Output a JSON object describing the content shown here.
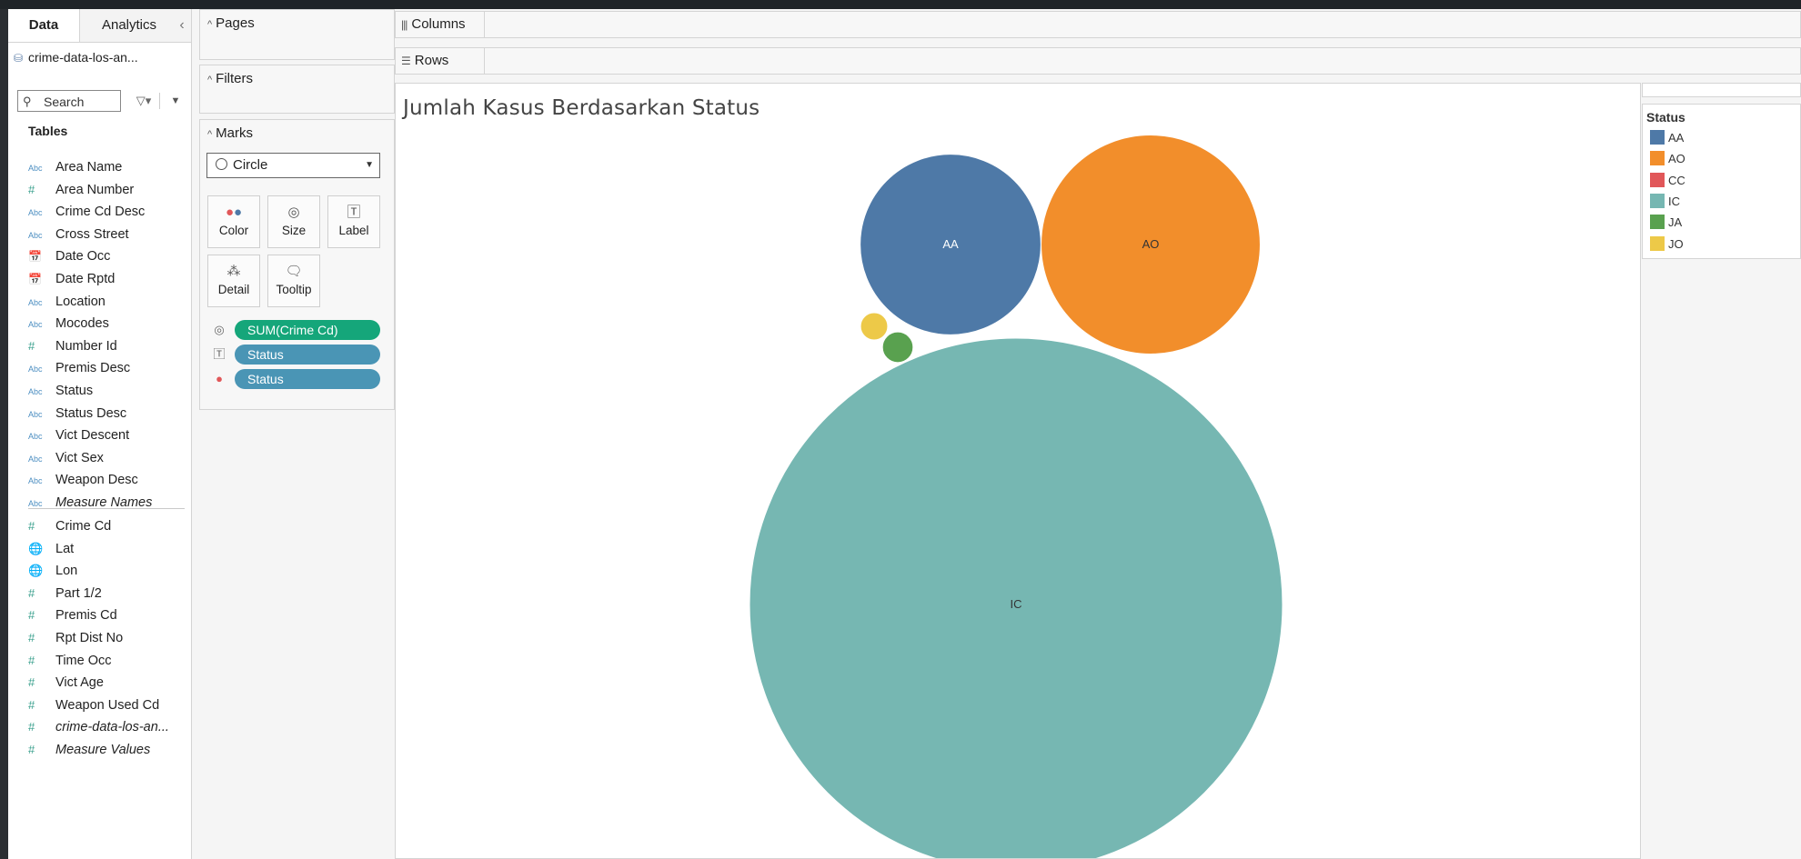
{
  "data_pane": {
    "tabs": [
      "Data",
      "Analytics"
    ],
    "datasource": "crime-data-los-an...",
    "search_placeholder": "Search",
    "tables_header": "Tables",
    "dimensions": [
      {
        "name": "Area Name",
        "type": "abc",
        "icon": "Abc"
      },
      {
        "name": "Area Number",
        "type": "num",
        "icon": "#"
      },
      {
        "name": "Crime Cd Desc",
        "type": "abc",
        "icon": "Abc"
      },
      {
        "name": "Cross Street",
        "type": "abc",
        "icon": "Abc"
      },
      {
        "name": "Date Occ",
        "type": "date",
        "icon": "📅"
      },
      {
        "name": "Date Rptd",
        "type": "date",
        "icon": "📅"
      },
      {
        "name": "Location",
        "type": "abc",
        "icon": "Abc"
      },
      {
        "name": "Mocodes",
        "type": "abc",
        "icon": "Abc"
      },
      {
        "name": "Number Id",
        "type": "num",
        "icon": "#"
      },
      {
        "name": "Premis Desc",
        "type": "abc",
        "icon": "Abc"
      },
      {
        "name": "Status",
        "type": "abc",
        "icon": "Abc"
      },
      {
        "name": "Status Desc",
        "type": "abc",
        "icon": "Abc"
      },
      {
        "name": "Vict Descent",
        "type": "abc",
        "icon": "Abc"
      },
      {
        "name": "Vict Sex",
        "type": "abc",
        "icon": "Abc"
      },
      {
        "name": "Weapon Desc",
        "type": "abc",
        "icon": "Abc"
      },
      {
        "name": "Measure Names",
        "type": "abc",
        "icon": "Abc",
        "italic": true
      }
    ],
    "measures": [
      {
        "name": "Crime Cd",
        "type": "num",
        "icon": "#"
      },
      {
        "name": "Lat",
        "type": "geo",
        "icon": "🌐"
      },
      {
        "name": "Lon",
        "type": "geo",
        "icon": "🌐"
      },
      {
        "name": "Part 1/2",
        "type": "num",
        "icon": "#"
      },
      {
        "name": "Premis Cd",
        "type": "num",
        "icon": "#"
      },
      {
        "name": "Rpt Dist No",
        "type": "num",
        "icon": "#"
      },
      {
        "name": "Time Occ",
        "type": "num",
        "icon": "#"
      },
      {
        "name": "Vict Age",
        "type": "num",
        "icon": "#"
      },
      {
        "name": "Weapon Used Cd",
        "type": "num",
        "icon": "#"
      },
      {
        "name": "crime-data-los-an...",
        "type": "num",
        "icon": "#",
        "italic": true
      },
      {
        "name": "Measure Values",
        "type": "num",
        "icon": "#",
        "italic": true
      }
    ]
  },
  "cards": {
    "pages": "Pages",
    "filters": "Filters",
    "marks": "Marks",
    "mark_type": "Circle",
    "mark_buttons": [
      {
        "label": "Color",
        "icon": "color-icon"
      },
      {
        "label": "Size",
        "icon": "size-icon"
      },
      {
        "label": "Label",
        "icon": "label-icon"
      },
      {
        "label": "Detail",
        "icon": "detail-icon"
      },
      {
        "label": "Tooltip",
        "icon": "tooltip-icon"
      }
    ],
    "pills": [
      {
        "label": "SUM(Crime Cd)",
        "encoding": "size",
        "color": "#15a67a"
      },
      {
        "label": "Status",
        "encoding": "label",
        "color": "#4a95b5"
      },
      {
        "label": "Status",
        "encoding": "color",
        "color": "#4a95b5"
      }
    ]
  },
  "shelves": {
    "columns": "Columns",
    "rows": "Rows"
  },
  "view": {
    "title": "Jumlah Kasus Berdasarkan Status"
  },
  "legend": {
    "title": "Status",
    "items": [
      {
        "label": "AA",
        "color": "#4e79a7"
      },
      {
        "label": "AO",
        "color": "#f28e2b"
      },
      {
        "label": "CC",
        "color": "#e15759"
      },
      {
        "label": "IC",
        "color": "#76b7b2"
      },
      {
        "label": "JA",
        "color": "#59a14f"
      },
      {
        "label": "JO",
        "color": "#edc948"
      }
    ]
  },
  "chart_data": {
    "type": "bubble",
    "title": "Jumlah Kasus Berdasarkan Status",
    "size_measure": "SUM(Crime Cd)",
    "color_dimension": "Status",
    "bubbles": [
      {
        "label": "IC",
        "value": 100.0,
        "color": "#76b7b2",
        "show_label": true
      },
      {
        "label": "AO",
        "value": 16.9,
        "color": "#f28e2b",
        "show_label": true
      },
      {
        "label": "AA",
        "value": 11.5,
        "color": "#4e79a7",
        "show_label": true
      },
      {
        "label": "JA",
        "value": 0.33,
        "color": "#59a14f",
        "show_label": false
      },
      {
        "label": "JO",
        "value": 0.26,
        "color": "#edc948",
        "show_label": false
      }
    ],
    "value_note": "relative size, IC = 100"
  }
}
